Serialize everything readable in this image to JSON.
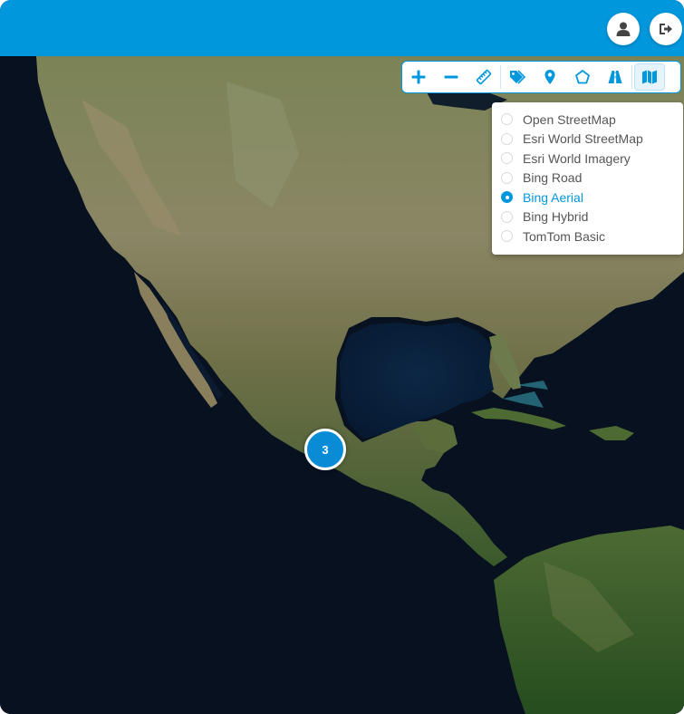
{
  "header": {
    "user_icon": "user-icon",
    "logout_icon": "sign-out-icon",
    "color": "#0097dd"
  },
  "toolbar": {
    "buttons": [
      {
        "name": "zoom-in-button",
        "icon": "plus-icon"
      },
      {
        "name": "zoom-out-button",
        "icon": "minus-icon"
      },
      {
        "name": "measure-button",
        "icon": "ruler-icon"
      },
      {
        "name": "tags-button",
        "icon": "tags-icon"
      },
      {
        "name": "marker-button",
        "icon": "map-pin-icon"
      },
      {
        "name": "draw-polygon-button",
        "icon": "pentagon-icon"
      },
      {
        "name": "road-button",
        "icon": "road-icon"
      },
      {
        "name": "layers-button",
        "icon": "map-icon",
        "active": true
      }
    ]
  },
  "layers": {
    "options": [
      {
        "label": "Open StreetMap",
        "selected": false
      },
      {
        "label": "Esri World StreetMap",
        "selected": false
      },
      {
        "label": "Esri World Imagery",
        "selected": false
      },
      {
        "label": "Bing Road",
        "selected": false
      },
      {
        "label": "Bing Aerial",
        "selected": true
      },
      {
        "label": "Bing Hybrid",
        "selected": false
      },
      {
        "label": "TomTom Basic",
        "selected": false
      }
    ]
  },
  "map": {
    "cluster_count": "3",
    "accent_color": "#0a8bd6",
    "ocean_color": "#07101d"
  }
}
